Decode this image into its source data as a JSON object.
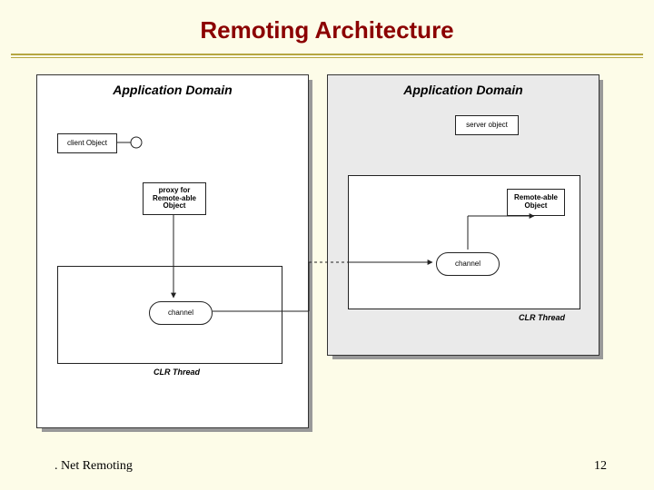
{
  "title": "Remoting Architecture",
  "left": {
    "heading": "Application Domain",
    "clientObject": "client Object",
    "proxy": "proxy for\nRemote-able\nObject",
    "channel": "channel",
    "clrThread": "CLR Thread"
  },
  "right": {
    "heading": "Application Domain",
    "serverObject": "server object",
    "remoteable": "Remote-able\nObject",
    "channel": "channel",
    "clrThread": "CLR Thread"
  },
  "footer": {
    "left": ". Net Remoting",
    "page": "12"
  }
}
